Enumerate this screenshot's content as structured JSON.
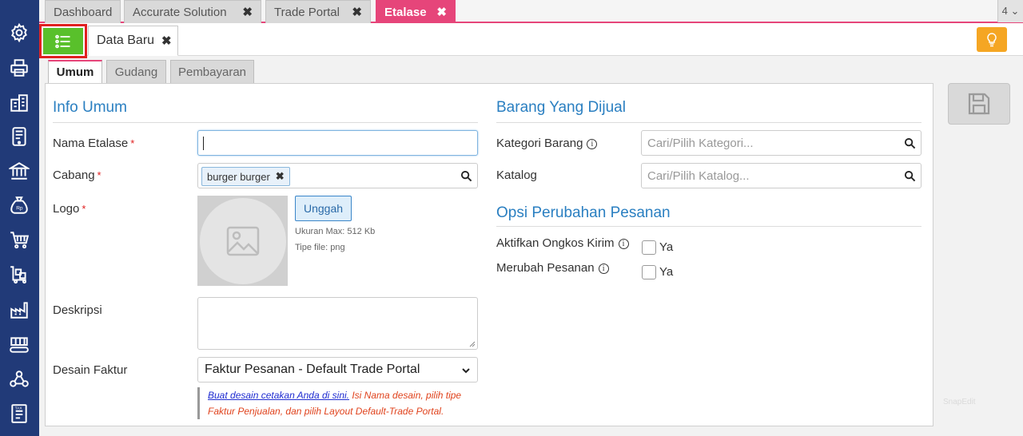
{
  "sidebar": {
    "icons": [
      "gear-icon",
      "printer-icon",
      "building-icon",
      "tablet-icon",
      "bank-icon",
      "money-bag-icon",
      "shopping-cart-icon",
      "cart-box-icon",
      "factory-icon",
      "conveyor-icon",
      "people-network-icon",
      "tax-document-icon"
    ],
    "bg": "#213a78"
  },
  "top_tabs": [
    {
      "label": "Dashboard",
      "closable": false
    },
    {
      "label": "Accurate Solution",
      "closable": true
    },
    {
      "label": "Trade Portal",
      "closable": true
    },
    {
      "label": "Etalase",
      "closable": true,
      "active": true
    }
  ],
  "tab_close_glyph": "✖",
  "tab_count": "4 ⌄",
  "sub_tab": {
    "label": "Data Baru"
  },
  "form_tabs": [
    {
      "label": "Umum",
      "active": true
    },
    {
      "label": "Gudang"
    },
    {
      "label": "Pembayaran"
    }
  ],
  "info_umum": {
    "title": "Info Umum",
    "nama_etalase_label": "Nama Etalase",
    "cabang_label": "Cabang",
    "cabang_chip": "burger burger",
    "logo_label": "Logo",
    "upload_label": "Unggah",
    "upload_max": "Ukuran Max: 512 Kb",
    "upload_type": "Tipe file: png",
    "deskripsi_label": "Deskripsi",
    "desain_faktur_label": "Desain Faktur",
    "desain_faktur_value": "Faktur Pesanan - Default Trade Portal",
    "required_mark": "*",
    "note_link": "Buat desain cetakan Anda di sini.",
    "note_text": " Isi Nama desain, pilih tipe Faktur Penjualan, dan pilih Layout Default-Trade Portal."
  },
  "barang_dijual": {
    "title": "Barang Yang Dijual",
    "kategori_label": "Kategori Barang",
    "kategori_placeholder": "Cari/Pilih Kategori...",
    "katalog_label": "Katalog",
    "katalog_placeholder": "Cari/Pilih Katalog..."
  },
  "opsi_perubahan": {
    "title": "Opsi Perubahan Pesanan",
    "ongkos_label": "Aktifkan Ongkos Kirim",
    "merubah_label": "Merubah Pesanan",
    "ya_label": "Ya"
  },
  "info_glyph": "i",
  "watermark": "SnapEdit",
  "colors": {
    "accent": "#e6457a",
    "section_title": "#2a7fc1",
    "menu_green": "#59c02b",
    "highlight_red": "#e02020",
    "bulb": "#f5a623"
  }
}
